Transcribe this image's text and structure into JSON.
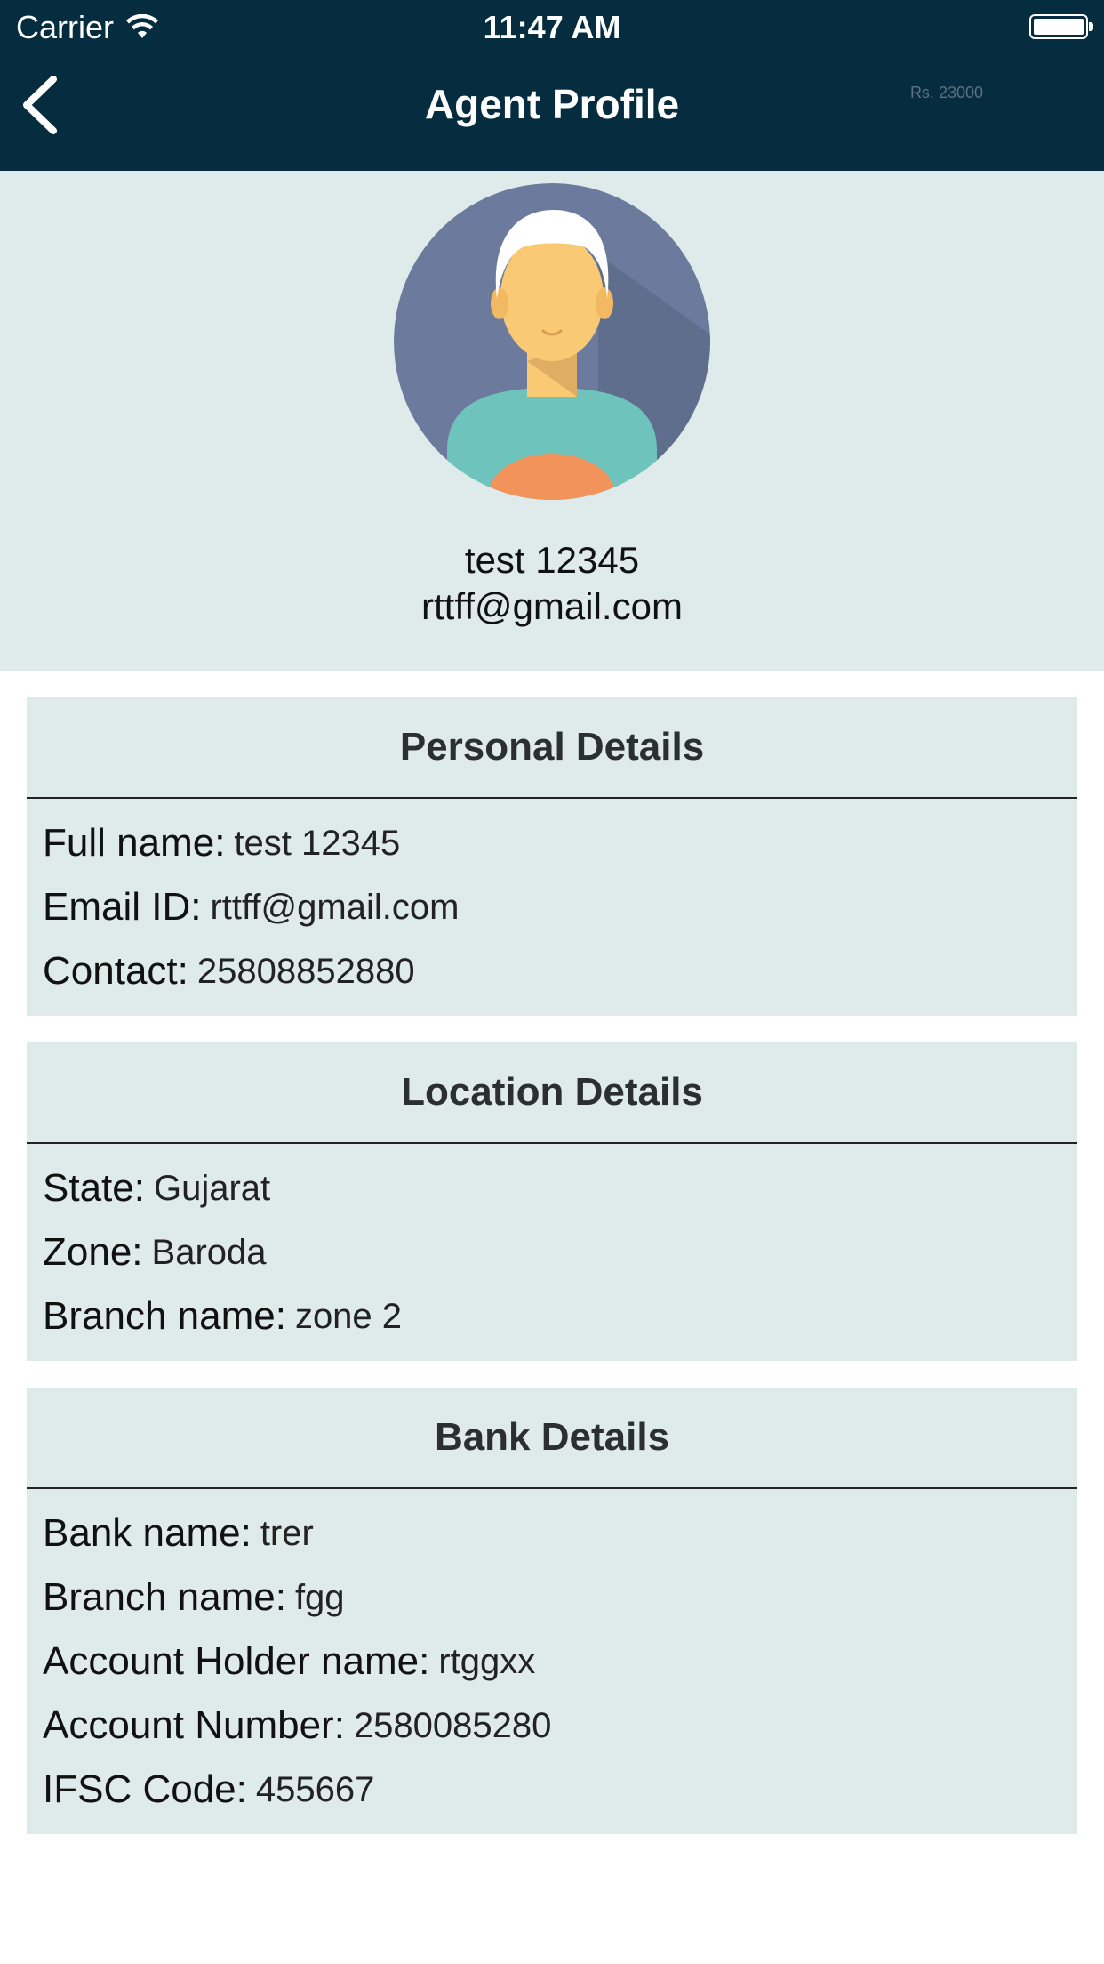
{
  "status_bar": {
    "carrier": "Carrier",
    "time": "11:47 AM"
  },
  "nav": {
    "title": "Agent Profile",
    "balance": "Rs. 23000",
    "back_icon": "chevron-left-icon"
  },
  "profile": {
    "name": "test 12345",
    "email": "rttff@gmail.com",
    "avatar_icon": "user-avatar-icon"
  },
  "sections": {
    "personal": {
      "title": "Personal Details",
      "rows": [
        {
          "label": "Full name:",
          "value": "test 12345"
        },
        {
          "label": "Email ID:",
          "value": "rttff@gmail.com"
        },
        {
          "label": "Contact:",
          "value": "25808852880"
        }
      ]
    },
    "location": {
      "title": "Location Details",
      "rows": [
        {
          "label": "State:",
          "value": "Gujarat"
        },
        {
          "label": "Zone:",
          "value": "Baroda"
        },
        {
          "label": "Branch name:",
          "value": "zone 2"
        }
      ]
    },
    "bank": {
      "title": "Bank Details",
      "rows": [
        {
          "label": "Bank name:",
          "value": "trer"
        },
        {
          "label": "Branch name:",
          "value": "fgg"
        },
        {
          "label": "Account Holder name:",
          "value": "rtggxx"
        },
        {
          "label": "Account Number:",
          "value": "2580085280"
        },
        {
          "label": "IFSC Code:",
          "value": "455667"
        }
      ]
    }
  },
  "colors": {
    "nav_bg": "#062d3f",
    "panel_bg": "#dfeaea",
    "avatar_bg": "#6b7a9d",
    "shirt": "#6fc3bd",
    "skin": "#f9c974",
    "hair": "#ffffff",
    "collar": "#f3935c"
  }
}
